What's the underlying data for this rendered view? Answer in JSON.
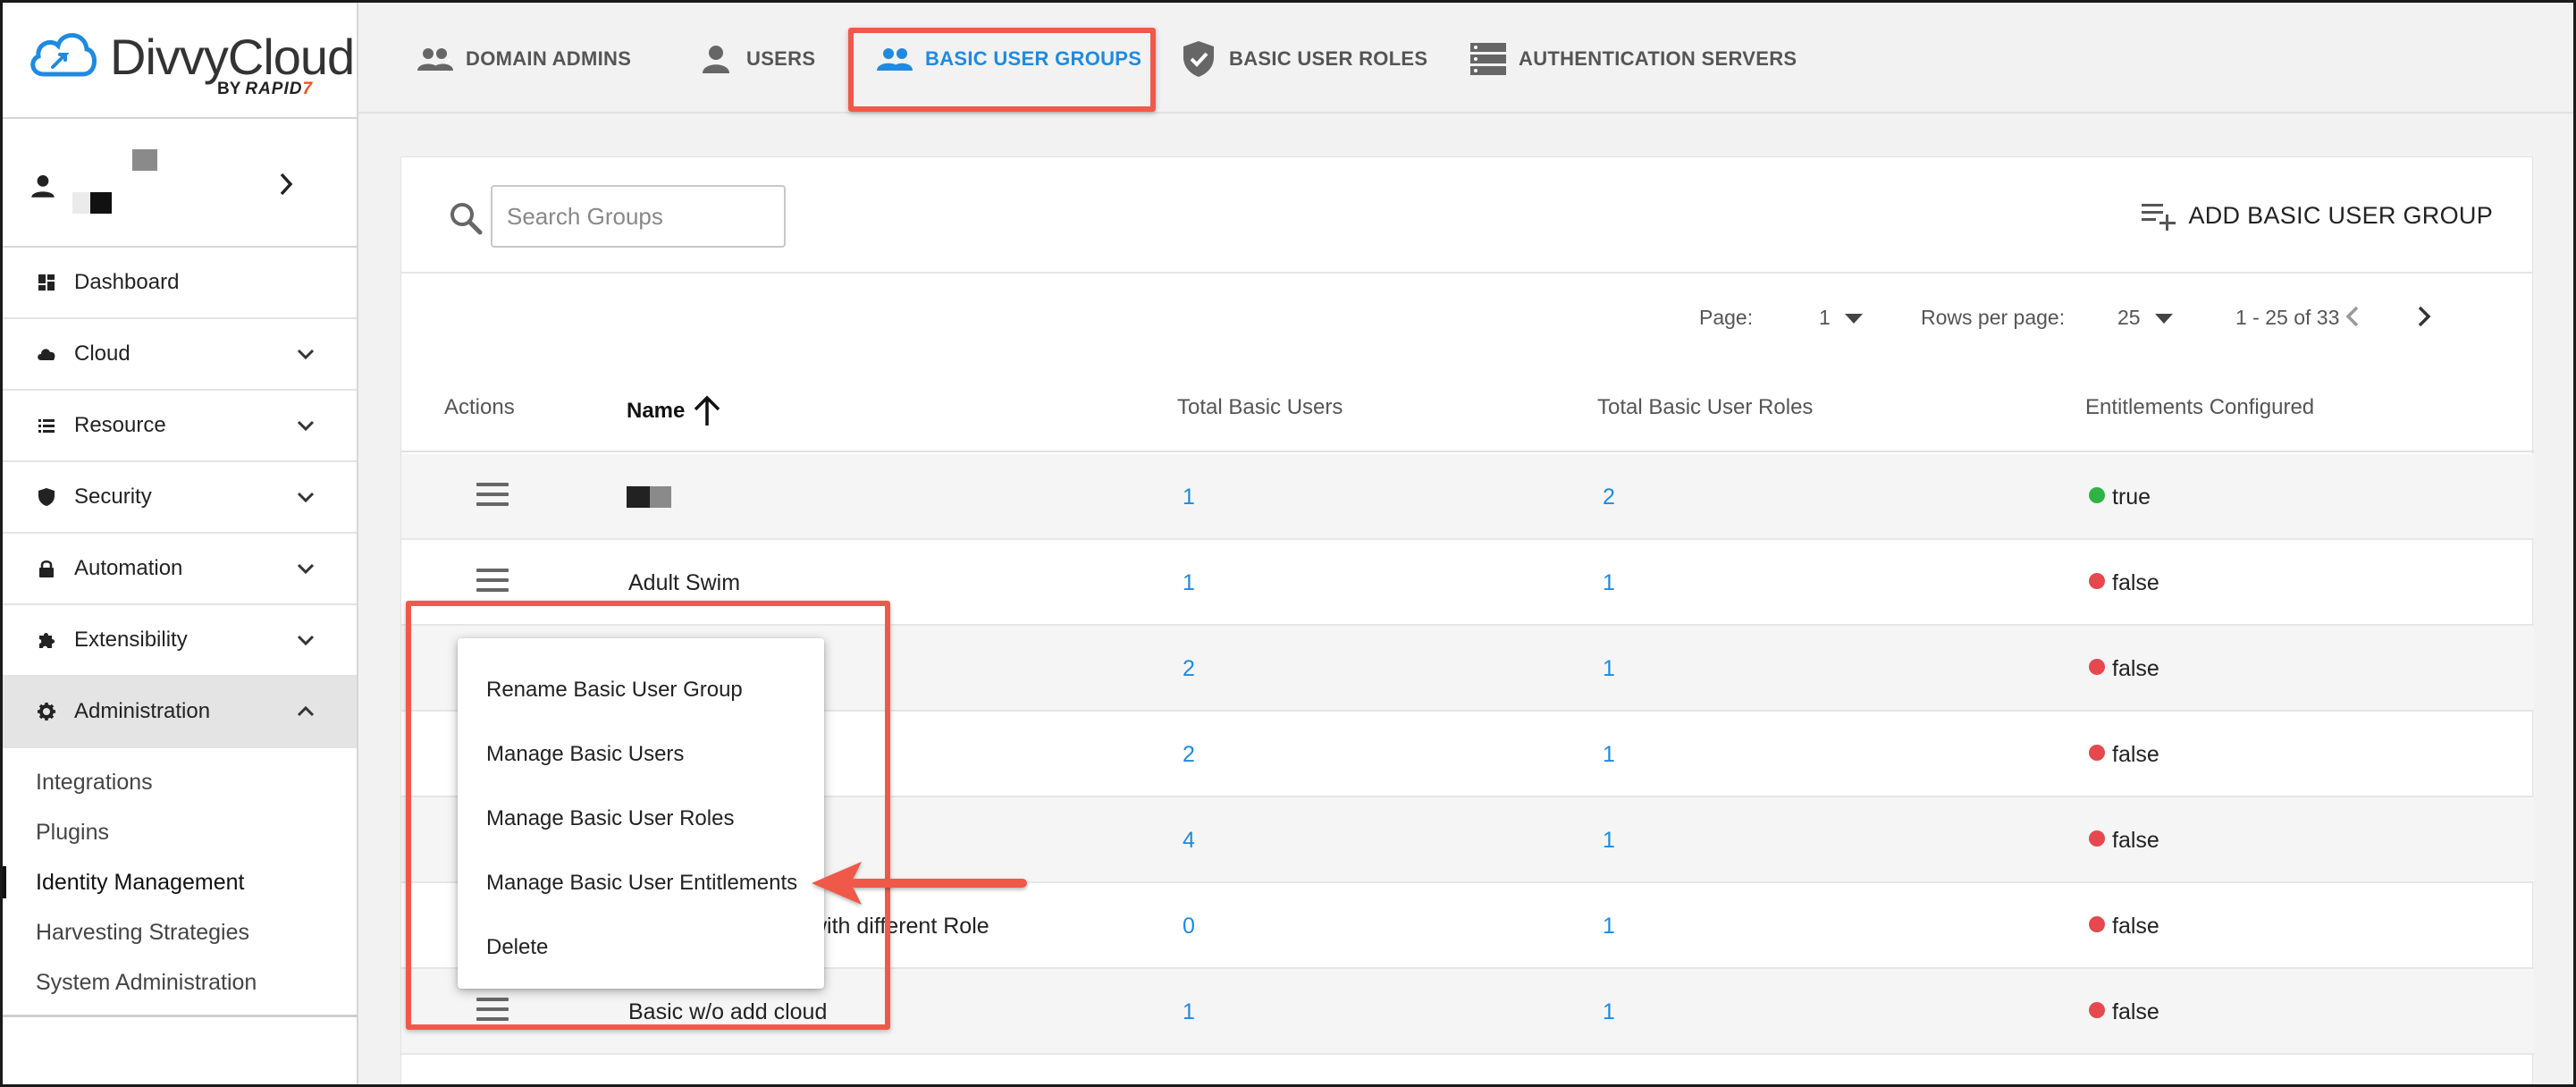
{
  "brand": {
    "name": "DivvyCloud",
    "byline_prefix": "BY",
    "byline_brand": "RAPID",
    "byline_mark": "7"
  },
  "sidebar": {
    "items": [
      {
        "label": "Dashboard",
        "icon": "dashboard-icon",
        "expandable": false
      },
      {
        "label": "Cloud",
        "icon": "cloud-icon",
        "expandable": true
      },
      {
        "label": "Resource",
        "icon": "list-icon",
        "expandable": true
      },
      {
        "label": "Security",
        "icon": "shield-icon",
        "expandable": true
      },
      {
        "label": "Automation",
        "icon": "lock-icon",
        "expandable": true
      },
      {
        "label": "Extensibility",
        "icon": "puzzle-icon",
        "expandable": true
      },
      {
        "label": "Administration",
        "icon": "gear-icon",
        "expandable": true,
        "expanded": true
      }
    ],
    "admin_sub_items": [
      {
        "label": "Integrations"
      },
      {
        "label": "Plugins"
      },
      {
        "label": "Identity Management",
        "current": true
      },
      {
        "label": "Harvesting Strategies"
      },
      {
        "label": "System Administration"
      }
    ]
  },
  "tabs": [
    {
      "label": "DOMAIN ADMINS",
      "icon": "admins-icon"
    },
    {
      "label": "USERS",
      "icon": "user-icon"
    },
    {
      "label": "BASIC USER GROUPS",
      "icon": "group-icon",
      "selected": true
    },
    {
      "label": "BASIC USER ROLES",
      "icon": "shield-check-icon"
    },
    {
      "label": "AUTHENTICATION SERVERS",
      "icon": "server-icon"
    }
  ],
  "search": {
    "placeholder": "Search Groups",
    "value": ""
  },
  "add_button": {
    "label": "ADD BASIC USER GROUP"
  },
  "pagination": {
    "page_label": "Page:",
    "page_value": "1",
    "rows_label": "Rows per page:",
    "rows_value": "25",
    "range": "1 - 25 of 33"
  },
  "table": {
    "columns": [
      "Actions",
      "Name",
      "Total Basic Users",
      "Total Basic User Roles",
      "Entitlements Configured"
    ],
    "rows": [
      {
        "name": "",
        "redacted": true,
        "users": "1",
        "roles": "2",
        "entitlements": "true"
      },
      {
        "name": "Adult Swim",
        "users": "1",
        "roles": "1",
        "entitlements": "false"
      },
      {
        "name": "",
        "users": "2",
        "roles": "1",
        "entitlements": "false"
      },
      {
        "name": "",
        "users": "2",
        "roles": "1",
        "entitlements": "false"
      },
      {
        "name": "",
        "users": "4",
        "roles": "1",
        "entitlements": "false"
      },
      {
        "name": "with different Role",
        "users": "0",
        "roles": "1",
        "entitlements": "false"
      },
      {
        "name": "Basic w/o add cloud",
        "users": "1",
        "roles": "1",
        "entitlements": "false"
      }
    ]
  },
  "context_menu": {
    "items": [
      {
        "label": "Rename Basic User Group"
      },
      {
        "label": "Manage Basic Users"
      },
      {
        "label": "Manage Basic User Roles"
      },
      {
        "label": "Manage Basic User Entitlements"
      },
      {
        "label": "Delete"
      }
    ]
  },
  "colors": {
    "accent": "#1f8ae0",
    "highlight": "#f0594a",
    "true_dot": "#2fb344",
    "false_dot": "#e5484d"
  }
}
